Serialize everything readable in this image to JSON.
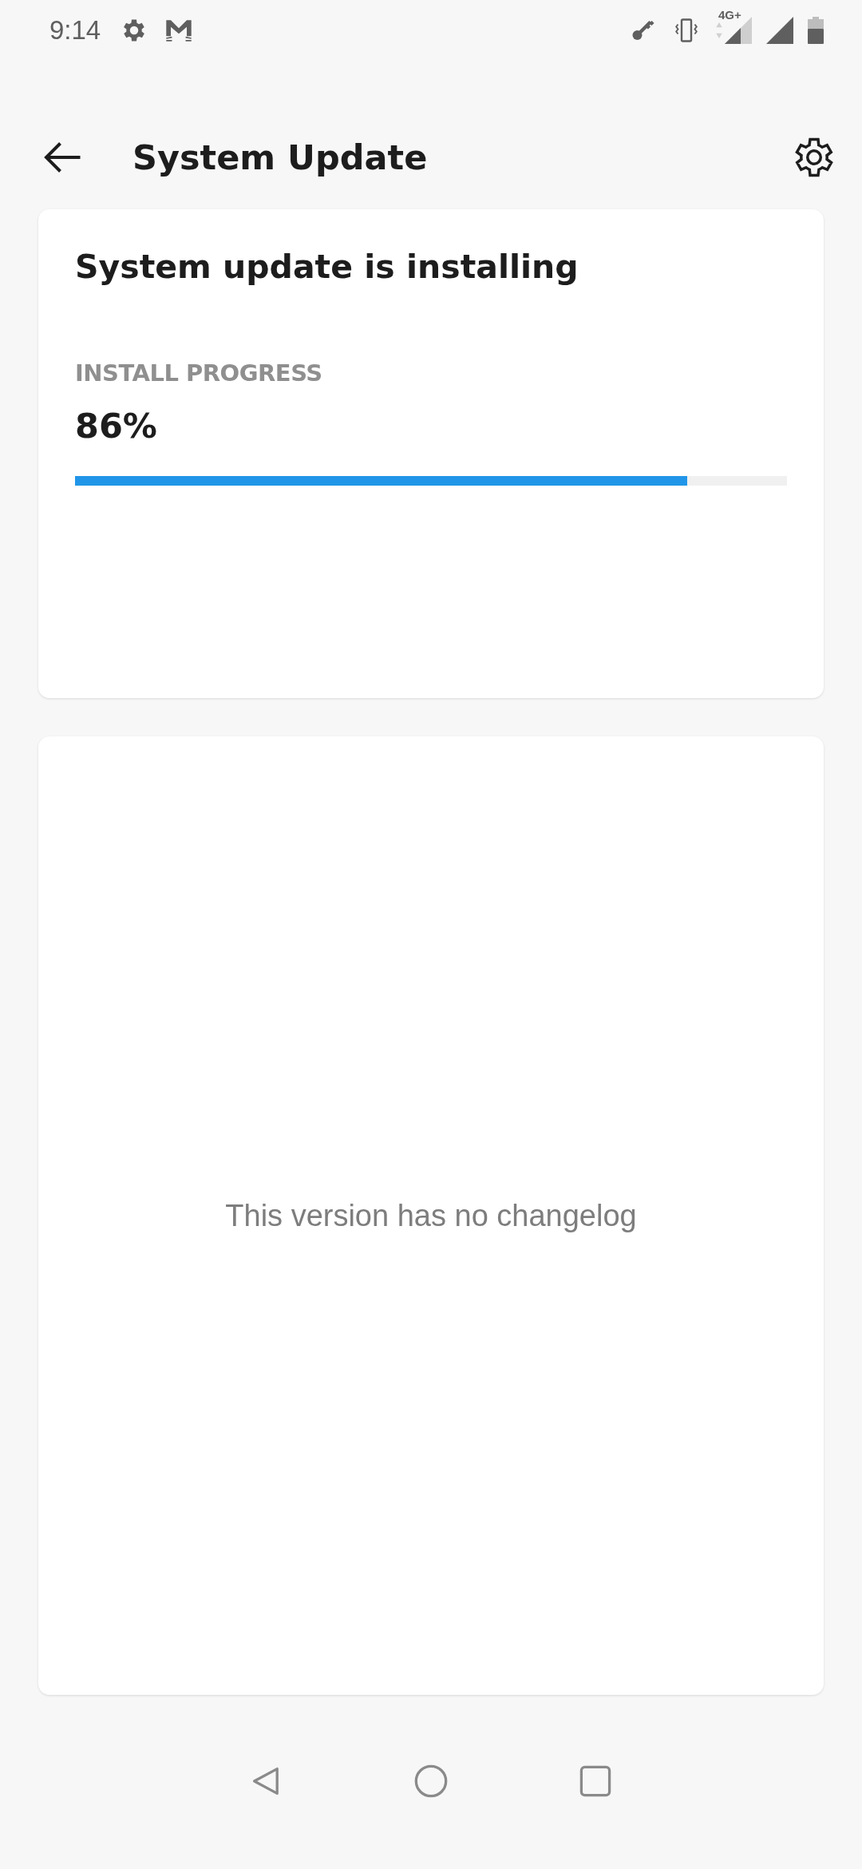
{
  "status_bar": {
    "time": "9:14",
    "network": "4G+"
  },
  "toolbar": {
    "title": "System Update"
  },
  "progress_card": {
    "title": "System update is installing",
    "label": "INSTALL PROGRESS",
    "percent": "86%",
    "level": 0.86
  },
  "changelog_card": {
    "message": "This version has no changelog"
  }
}
